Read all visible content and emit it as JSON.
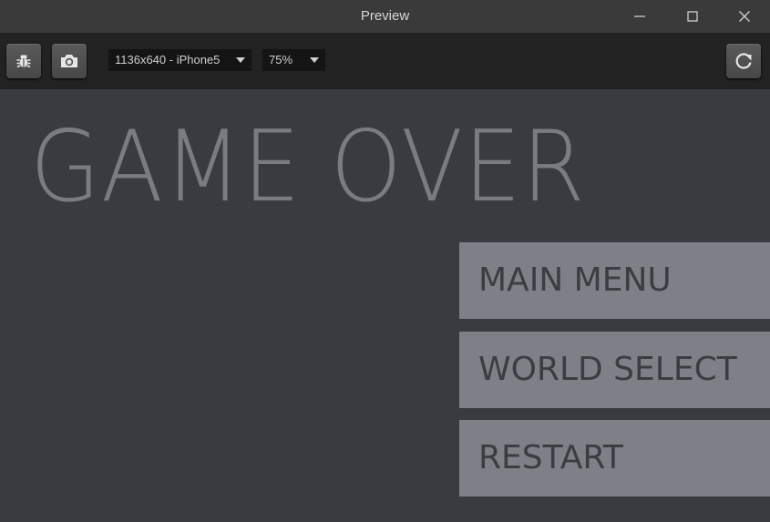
{
  "window": {
    "title": "Preview",
    "controls": [
      "minimize-icon",
      "maximize-icon",
      "close-icon"
    ]
  },
  "toolbar": {
    "buttons": [
      "bug-icon",
      "camera-icon",
      "refresh-icon"
    ],
    "device_select": {
      "value": "1136x640 - iPhone5"
    },
    "zoom_select": {
      "value": "75%"
    }
  },
  "game": {
    "title": "GAME OVER",
    "menu": {
      "main_menu": "MAIN MENU",
      "world_select": "WORLD SELECT",
      "restart": "RESTART"
    }
  },
  "colors": {
    "stage_background": "#383b40",
    "title_text": "#797c81",
    "button_background": "#7d8187",
    "button_text": "#3a3d42"
  }
}
